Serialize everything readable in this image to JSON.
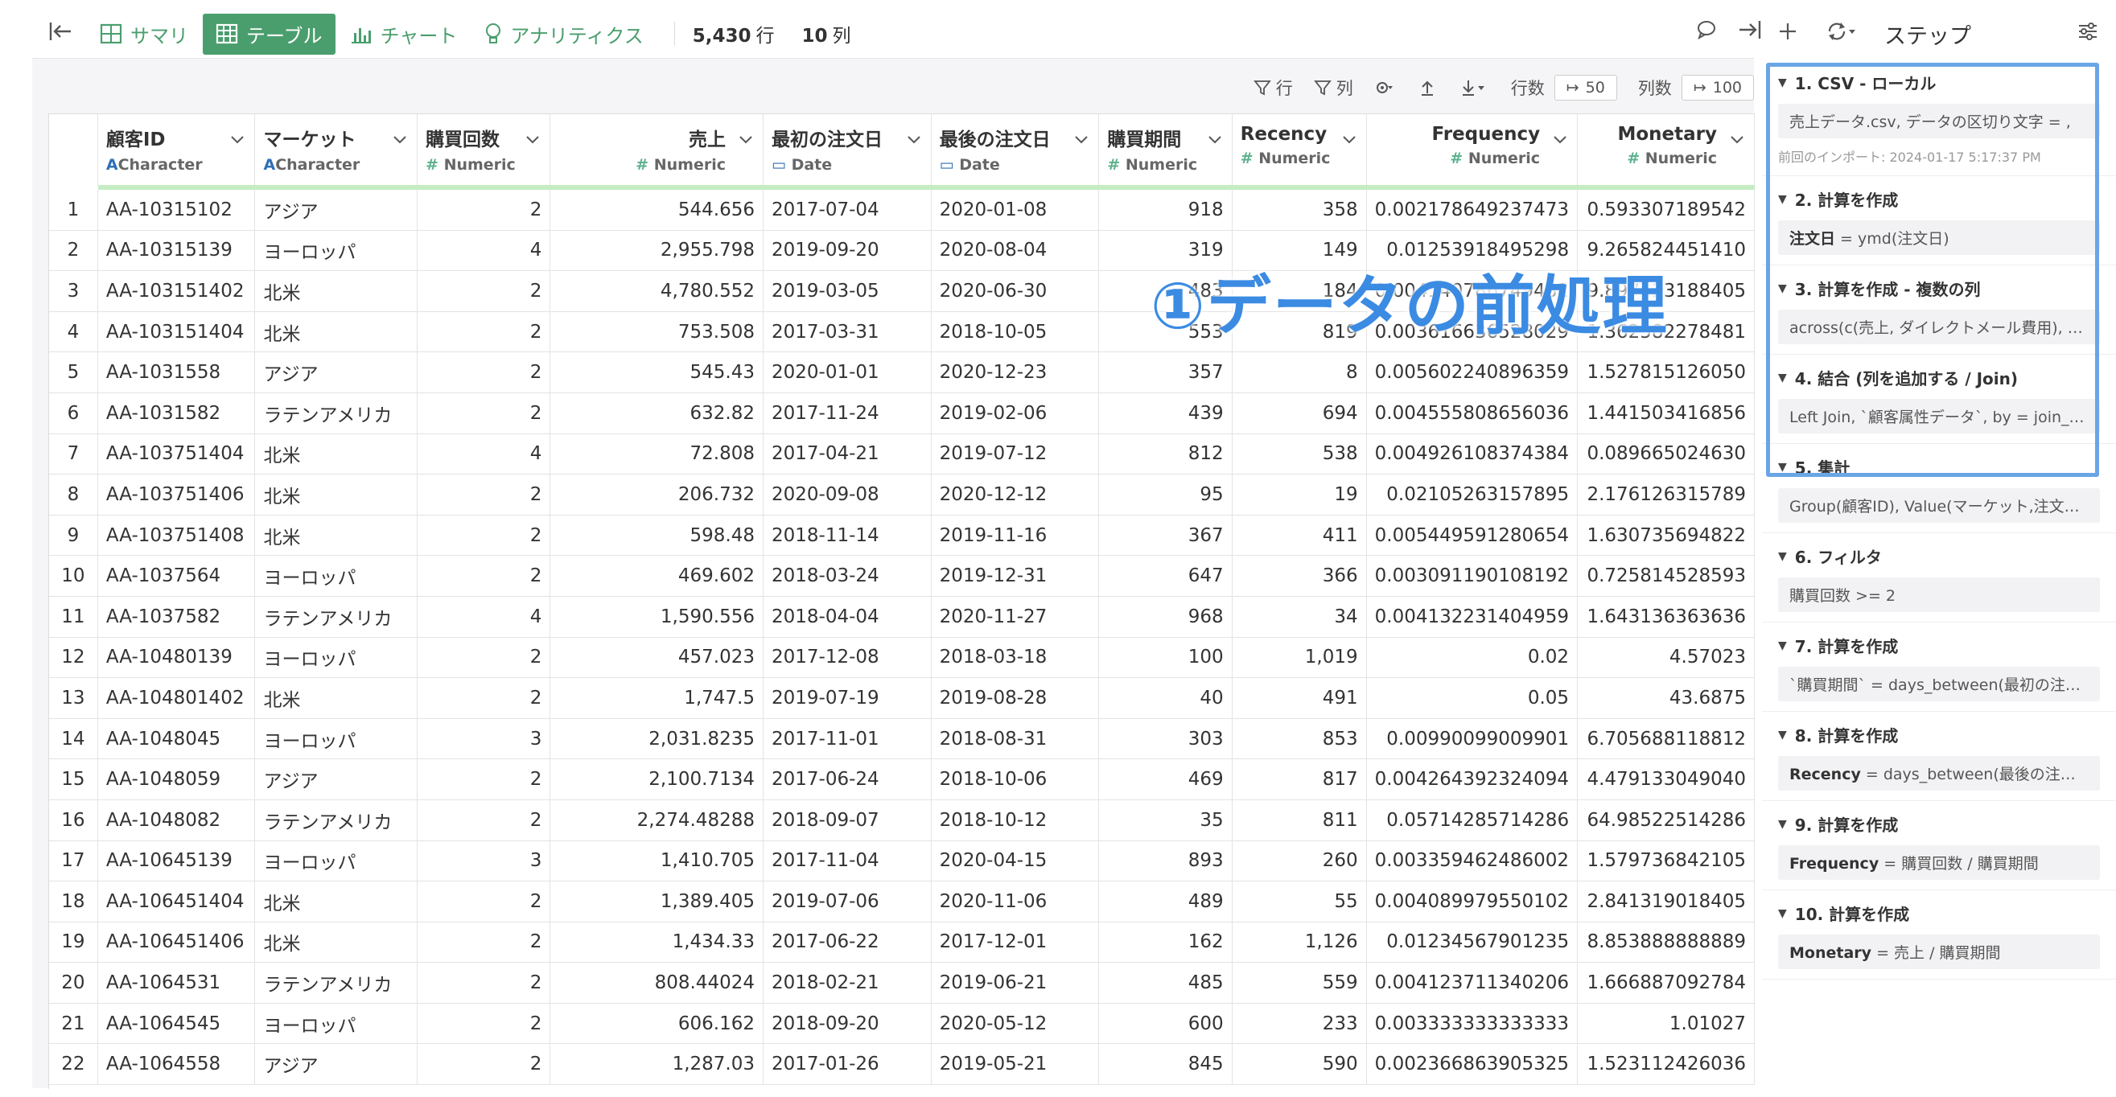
{
  "toolbar": {
    "tabs": [
      {
        "label": "サマリ",
        "icon": "summary-icon"
      },
      {
        "label": "テーブル",
        "icon": "table-icon",
        "active": true
      },
      {
        "label": "チャート",
        "icon": "chart-icon"
      },
      {
        "label": "アナリティクス",
        "icon": "bulb-icon"
      }
    ],
    "rows_value": "5,430",
    "rows_unit": "行",
    "cols_value": "10",
    "cols_unit": "列"
  },
  "table_tools": {
    "row_label": "行",
    "col_label": "列",
    "rowcount_label": "行数",
    "rowcount_value": "50",
    "colcount_label": "列数",
    "colcount_value": "100"
  },
  "columns": [
    {
      "name": "顧客ID",
      "type": "Character",
      "kind": "char",
      "align": "left"
    },
    {
      "name": "マーケット",
      "type": "Character",
      "kind": "char",
      "align": "left"
    },
    {
      "name": "購買回数",
      "type": "Numeric",
      "kind": "num",
      "align": "left"
    },
    {
      "name": "売上",
      "type": "Numeric",
      "kind": "num",
      "align": "right"
    },
    {
      "name": "最初の注文日",
      "type": "Date",
      "kind": "date",
      "align": "left"
    },
    {
      "name": "最後の注文日",
      "type": "Date",
      "kind": "date",
      "align": "left"
    },
    {
      "name": "購買期間",
      "type": "Numeric",
      "kind": "num",
      "align": "left"
    },
    {
      "name": "Recency",
      "type": "Numeric",
      "kind": "num",
      "align": "left"
    },
    {
      "name": "Frequency",
      "type": "Numeric",
      "kind": "num",
      "align": "right"
    },
    {
      "name": "Monetary",
      "type": "Numeric",
      "kind": "num",
      "align": "right"
    }
  ],
  "rows": [
    [
      "1",
      "AA-10315102",
      "アジア",
      "2",
      "544.656",
      "2017-07-04",
      "2020-01-08",
      "918",
      "358",
      "0.002178649237473",
      "0.593307189542"
    ],
    [
      "2",
      "AA-10315139",
      "ヨーロッパ",
      "4",
      "2,955.798",
      "2019-09-20",
      "2020-08-04",
      "319",
      "149",
      "0.01253918495298",
      "9.265824451410"
    ],
    [
      "3",
      "AA-103151402",
      "北米",
      "2",
      "4,780.552",
      "2019-03-05",
      "2020-06-30",
      "483",
      "184",
      "0.004140786749482",
      "9.897623188405"
    ],
    [
      "4",
      "AA-103151404",
      "北米",
      "2",
      "753.508",
      "2017-03-31",
      "2018-10-05",
      "553",
      "819",
      "0.003616636528029",
      "1.362582278481"
    ],
    [
      "5",
      "AA-1031558",
      "アジア",
      "2",
      "545.43",
      "2020-01-01",
      "2020-12-23",
      "357",
      "8",
      "0.005602240896359",
      "1.527815126050"
    ],
    [
      "6",
      "AA-1031582",
      "ラテンアメリカ",
      "2",
      "632.82",
      "2017-11-24",
      "2019-02-06",
      "439",
      "694",
      "0.004555808656036",
      "1.441503416856"
    ],
    [
      "7",
      "AA-103751404",
      "北米",
      "4",
      "72.808",
      "2017-04-21",
      "2019-07-12",
      "812",
      "538",
      "0.004926108374384",
      "0.089665024630"
    ],
    [
      "8",
      "AA-103751406",
      "北米",
      "2",
      "206.732",
      "2020-09-08",
      "2020-12-12",
      "95",
      "19",
      "0.02105263157895",
      "2.176126315789"
    ],
    [
      "9",
      "AA-103751408",
      "北米",
      "2",
      "598.48",
      "2018-11-14",
      "2019-11-16",
      "367",
      "411",
      "0.005449591280654",
      "1.630735694822"
    ],
    [
      "10",
      "AA-1037564",
      "ヨーロッパ",
      "2",
      "469.602",
      "2018-03-24",
      "2019-12-31",
      "647",
      "366",
      "0.003091190108192",
      "0.725814528593"
    ],
    [
      "11",
      "AA-1037582",
      "ラテンアメリカ",
      "4",
      "1,590.556",
      "2018-04-04",
      "2020-11-27",
      "968",
      "34",
      "0.004132231404959",
      "1.643136363636"
    ],
    [
      "12",
      "AA-10480139",
      "ヨーロッパ",
      "2",
      "457.023",
      "2017-12-08",
      "2018-03-18",
      "100",
      "1,019",
      "0.02",
      "4.57023"
    ],
    [
      "13",
      "AA-104801402",
      "北米",
      "2",
      "1,747.5",
      "2019-07-19",
      "2019-08-28",
      "40",
      "491",
      "0.05",
      "43.6875"
    ],
    [
      "14",
      "AA-1048045",
      "ヨーロッパ",
      "3",
      "2,031.8235",
      "2017-11-01",
      "2018-08-31",
      "303",
      "853",
      "0.00990099009901",
      "6.705688118812"
    ],
    [
      "15",
      "AA-1048059",
      "アジア",
      "2",
      "2,100.7134",
      "2017-06-24",
      "2018-10-06",
      "469",
      "817",
      "0.004264392324094",
      "4.479133049040"
    ],
    [
      "16",
      "AA-1048082",
      "ラテンアメリカ",
      "2",
      "2,274.48288",
      "2018-09-07",
      "2018-10-12",
      "35",
      "811",
      "0.05714285714286",
      "64.98522514286"
    ],
    [
      "17",
      "AA-10645139",
      "ヨーロッパ",
      "3",
      "1,410.705",
      "2017-11-04",
      "2020-04-15",
      "893",
      "260",
      "0.003359462486002",
      "1.579736842105"
    ],
    [
      "18",
      "AA-106451404",
      "北米",
      "2",
      "1,389.405",
      "2019-07-06",
      "2020-11-06",
      "489",
      "55",
      "0.004089979550102",
      "2.841319018405"
    ],
    [
      "19",
      "AA-106451406",
      "北米",
      "2",
      "1,434.33",
      "2017-06-22",
      "2017-12-01",
      "162",
      "1,126",
      "0.01234567901235",
      "8.853888888889"
    ],
    [
      "20",
      "AA-1064531",
      "ラテンアメリカ",
      "2",
      "808.44024",
      "2018-02-21",
      "2019-06-21",
      "485",
      "559",
      "0.004123711340206",
      "1.666887092784"
    ],
    [
      "21",
      "AA-1064545",
      "ヨーロッパ",
      "2",
      "606.162",
      "2018-09-20",
      "2020-05-12",
      "600",
      "233",
      "0.003333333333333",
      "1.01027"
    ],
    [
      "22",
      "AA-1064558",
      "アジア",
      "2",
      "1,287.03",
      "2017-01-26",
      "2019-05-21",
      "845",
      "590",
      "0.002366863905325",
      "1.523112426036"
    ]
  ],
  "annotation": "①データの前処理",
  "panel": {
    "title": "ステップ",
    "steps": [
      {
        "title": "1. CSV - ローカル",
        "body": "売上データ.csv, データの区切り文字 = ,",
        "meta": "前回のインポート: 2024-01-17 5:17:37 PM"
      },
      {
        "title": "2. 計算を作成",
        "strong": "注文日",
        "body": " = ymd(注文日)"
      },
      {
        "title": "3. 計算を作成 - 複数の列",
        "body": "across(c(売上, ダイレクトメール費用), ~as.numeric(.))"
      },
      {
        "title": "4. 結合 (列を追加する / Join)",
        "body": "Left Join, `顧客属性データ`, by = join_by(顧客ID)"
      },
      {
        "title": "5. 集計",
        "body": "Group(顧客ID), Value(マーケット,注文日,売上)"
      },
      {
        "title": "6. フィルタ",
        "body": "購買回数 >= 2"
      },
      {
        "title": "7. 計算を作成",
        "body": "`購買期間` = days_between(最初の注文日, 最後の注文日)"
      },
      {
        "title": "8. 計算を作成",
        "strong": "Recency",
        "body": " = days_between(最後の注文日, today())"
      },
      {
        "title": "9. 計算を作成",
        "strong": "Frequency",
        "body": " = 購買回数 / 購買期間"
      },
      {
        "title": "10. 計算を作成",
        "strong": "Monetary",
        "body": " = 売上 / 購買期間"
      }
    ]
  },
  "colors": {
    "accent": "#4a9e6e",
    "highlight": "#6aa5e6",
    "annotation": "#3b8be3"
  }
}
